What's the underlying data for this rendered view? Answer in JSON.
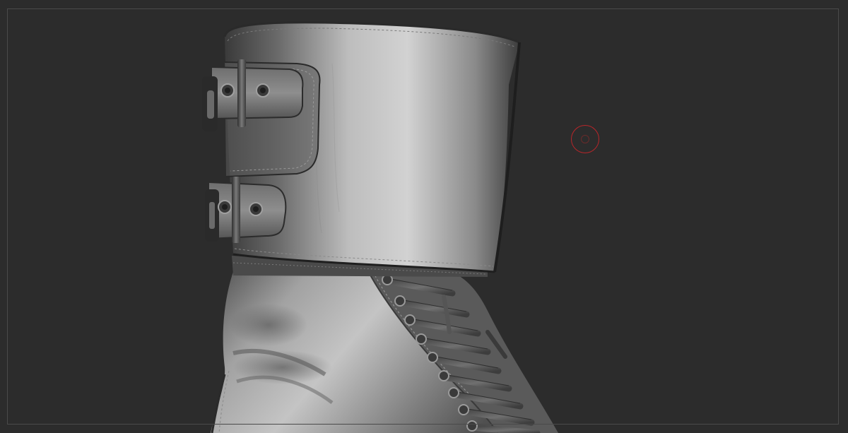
{
  "viewport": {
    "background": "#2c2c2c",
    "frame_color": "#4a4a4a",
    "model": "sculpted-leather-boot",
    "material": "grey-matcap"
  },
  "brush_cursor": {
    "icon": "brush-circle-icon",
    "color": "#b8262a"
  }
}
